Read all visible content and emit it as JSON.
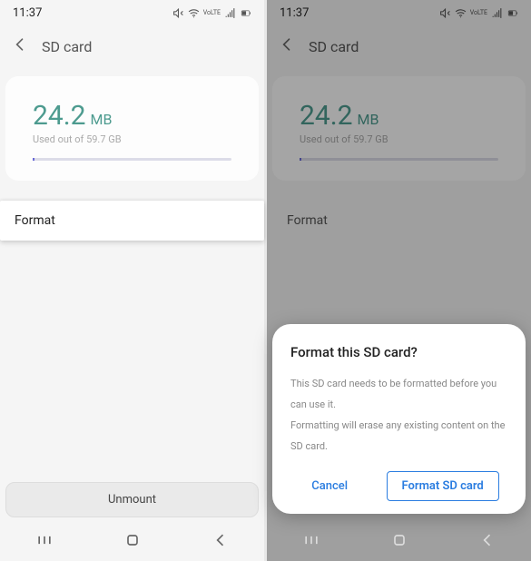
{
  "status": {
    "time": "11:37"
  },
  "header": {
    "title": "SD card"
  },
  "storage": {
    "used_value": "24.2",
    "used_unit": "MB",
    "subtext": "Used out of 59.7 GB"
  },
  "actions": {
    "format": "Format",
    "unmount": "Unmount"
  },
  "dialog": {
    "title": "Format this SD card?",
    "line1": "This SD card needs to be formatted before you can use it.",
    "line2": "Formatting will erase any existing content on the SD card.",
    "cancel": "Cancel",
    "confirm": "Format SD card"
  }
}
